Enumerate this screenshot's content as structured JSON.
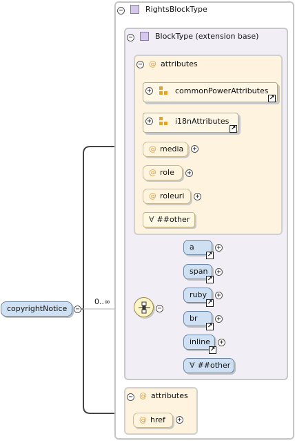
{
  "root": {
    "label": "copyrightNotice",
    "cardinality": "0..∞"
  },
  "complex_type": {
    "title": "RightsBlockType"
  },
  "extension": {
    "title": "BlockType (extension base)"
  },
  "attribute_group": {
    "title": "attributes",
    "groups": [
      {
        "label": "commonPowerAttributes"
      },
      {
        "label": "i18nAttributes"
      }
    ],
    "attributes": [
      {
        "label": "media"
      },
      {
        "label": "role"
      },
      {
        "label": "roleuri"
      }
    ],
    "any_attribute": "##other"
  },
  "choice": {
    "elements": [
      {
        "label": "a"
      },
      {
        "label": "span"
      },
      {
        "label": "ruby"
      },
      {
        "label": "br"
      },
      {
        "label": "inline"
      }
    ],
    "any_element": "##other"
  },
  "own_attributes": {
    "title": "attributes",
    "attributes": [
      {
        "label": "href"
      }
    ]
  },
  "symbols": {
    "at": "@",
    "forall": "∀",
    "plus": "+",
    "minus": "−",
    "link": "↗"
  },
  "colors": {
    "attr_fill": "#fff5de",
    "element_fill": "#cfe0f3",
    "type_fill": "#f1eef6",
    "attr_group_fill": "#fdf3df"
  }
}
